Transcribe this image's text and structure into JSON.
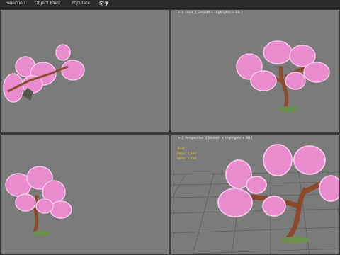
{
  "menubar": {
    "items": [
      "Selection",
      "Object Paint",
      "Populate"
    ],
    "eye_label": "▼"
  },
  "viewports": {
    "top_left": {
      "label": ""
    },
    "top_right": {
      "label": "[ + ][ Front ][ Smooth + Highlights + BB ]"
    },
    "bottom_left": {
      "label": ""
    },
    "bottom_right": {
      "label": "[ + ][ Perspective ][ Smooth + Highlights + BB ]",
      "stats_title": "Total",
      "polys": "Polys: 1,987",
      "verts": "Verts: 2,489"
    }
  },
  "colors": {
    "viewport_bg": "#7b7b7b",
    "blossom": "#e98ccd",
    "blossom_light": "#f6c6ea",
    "trunk": "#8a4a2b",
    "stats": "#e8c840"
  }
}
